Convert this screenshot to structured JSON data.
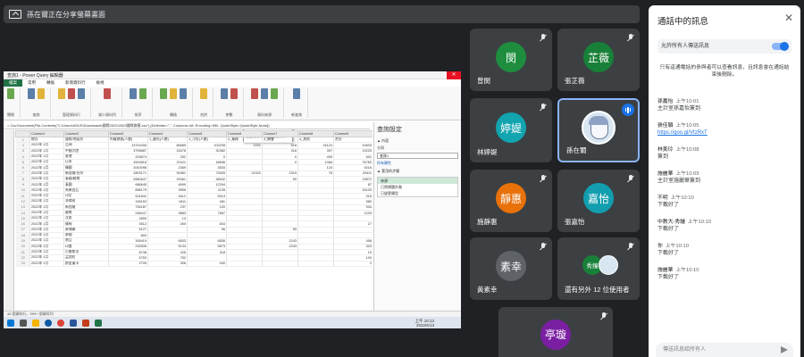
{
  "banner": {
    "text": "孫在爾正在分享螢幕畫面"
  },
  "shared_screen": {
    "window_title": "查詢1 - Power Query 編輯器",
    "tabs": [
      "檔案",
      "常用",
      "轉換",
      "新增資料行",
      "檢視"
    ],
    "ribbon_groups": [
      "關閉",
      "查詢",
      "管理資料行",
      "減少資料列",
      "排序",
      "轉換",
      "合併",
      "參數",
      "資料來源",
      "新查詢"
    ],
    "tooltip": {
      "title": "合併查詢",
      "body": "根據這些欄位中的值來合併這個查詢與另一個查詢的資料。"
    },
    "formula": "= Csv.Document(File.Contents(\"C:\\Users\\ASUS\\Downloads\\國際2022\\2022國際旅客.csv\"),[Delimiter=\",\", Columns=48, Encoding=950, QuoteStyle=QuoteStyle.None])",
    "columns": [
      "",
      "Column1",
      "Column2",
      "Column3",
      "Column4",
      "Column5",
      "Column6",
      "Column7",
      "Column8",
      "Column9"
    ],
    "rows": [
      [
        "1",
        "統計",
        "國際/地區別",
        "外籍旅客(人數)",
        "1_觀光(人數)",
        "1_小計(人數)",
        "2_業務",
        "3_開會",
        "4_其他",
        "合計"
      ],
      [
        "2",
        "2022年 1月",
        "亞洲",
        "13724406",
        "66589",
        "102208",
        "2201",
        "618",
        "24124",
        "10603"
      ],
      [
        "3",
        "2022年 1月",
        "中國大陸",
        "3796887",
        "15478",
        "30382",
        "",
        "316",
        "397",
        "19225"
      ],
      [
        "4",
        "2022年 1月",
        "香港",
        "203874",
        "252",
        "0",
        "",
        "0",
        "405",
        "601"
      ],
      [
        "5",
        "2022年 1月",
        "日本",
        "4524818",
        "22421",
        "18696",
        "",
        "0",
        "1066",
        "76760"
      ],
      [
        "6",
        "2022年 1月",
        "韓國",
        "2043098",
        "2359",
        "3533",
        "",
        "",
        "124",
        "9216"
      ],
      [
        "7",
        "2022年 1月",
        "新加坡/台灣",
        "2803171",
        "91861",
        "72605",
        "21922",
        "2315",
        "78",
        "29411"
      ],
      [
        "8",
        "2022年 1月",
        "泰國/越南",
        "2680647",
        "29361",
        "38942",
        "",
        "59",
        "",
        "23872"
      ],
      [
        "9",
        "2022年 1月",
        "泰國",
        "686645",
        "4699",
        "12294",
        "",
        "",
        "",
        "87"
      ],
      [
        "10",
        "2022年 1月",
        "馬來西亞",
        "858179",
        "2896",
        "1126",
        "",
        "",
        "",
        "16133"
      ],
      [
        "11",
        "2022年 1月",
        "印尼",
        "521842",
        "4612",
        "5913",
        "",
        "",
        "",
        "915"
      ],
      [
        "12",
        "2022年 1月",
        "菲律賓",
        "199153",
        "1811",
        "481",
        "",
        "",
        "",
        "580"
      ],
      [
        "13",
        "2022年 1月",
        "新加坡",
        "754187",
        "237",
        "100",
        "",
        "",
        "",
        "934"
      ],
      [
        "14",
        "2022年 1月",
        "越南",
        "248447",
        "3883",
        "7867",
        "",
        "",
        "",
        "1229"
      ],
      [
        "15",
        "2022年 1月",
        "汶萊",
        "2899",
        "13",
        "",
        "",
        "",
        "",
        ""
      ],
      [
        "16",
        "2022年 1月",
        "緬甸",
        "3512",
        "260",
        "834",
        "",
        "",
        "",
        "27"
      ],
      [
        "17",
        "2022年 1月",
        "柬埔寨",
        "5127",
        "",
        "96",
        "",
        "59",
        "",
        ""
      ],
      [
        "18",
        "2022年 1月",
        "寮國",
        "800",
        "",
        "",
        "",
        "",
        "",
        ""
      ],
      [
        "19",
        "2022年 1月",
        "南亞",
        "309419",
        "6833",
        "6838",
        "",
        "2243",
        "",
        "458"
      ],
      [
        "20",
        "2022年 1月",
        "印度",
        "292835",
        "5134",
        "5873",
        "",
        "2243",
        "",
        "323"
      ],
      [
        "21",
        "2022年 1月",
        "巴基斯坦",
        "8748",
        "426",
        "318",
        "",
        "",
        "",
        "19"
      ],
      [
        "22",
        "2022年 1月",
        "孟加拉",
        "5753",
        "752",
        "",
        "",
        "",
        "",
        "100"
      ],
      [
        "23",
        "2022年 1月",
        "斯里蘭卡",
        "2705",
        "306",
        "440",
        "",
        "",
        "",
        "2"
      ]
    ],
    "query_settings": {
      "title": "查詢設定",
      "properties_label": "▲ 內容",
      "name_label": "名稱",
      "name_value": "查詢1",
      "all_props_link": "所有屬性",
      "steps_label": "▲ 套用的步驟",
      "steps": [
        "來源",
        "已將標題升階",
        "已變更類型"
      ]
    },
    "status": "48 個資料行、999+ 個資料列",
    "clock": {
      "time": "上午 10:13",
      "date": "2022/6/13"
    }
  },
  "participants": [
    {
      "name": "曾閔",
      "initials": "閔",
      "color": "#1e8e3e"
    },
    {
      "name": "張芷薇",
      "initials": "芷薇",
      "color": "#188038"
    },
    {
      "name": "林婷媞",
      "initials": "婷媞",
      "color": "#12a4af"
    },
    {
      "name": "孫在爾",
      "initials": "",
      "color": "#d7e6f0"
    },
    {
      "name": "施靜惠",
      "initials": "靜惠",
      "color": "#e8710a"
    },
    {
      "name": "張嘉怡",
      "initials": "嘉怡",
      "color": "#129eaf"
    },
    {
      "name": "黃素幸",
      "initials": "素幸",
      "color": "#5f6368"
    },
    {
      "name": "還有另外 12 位使用者",
      "initials": "秀鐘",
      "color": "#188038"
    },
    {
      "name": "",
      "initials": "亭璇",
      "color": "#7b1fa2"
    }
  ],
  "chat": {
    "title": "通話中的訊息",
    "toggle_label": "允許所有人傳送訊息",
    "info": "只有這通電話的參與者可以查看訊息，且訊息會在通話結束後刪除。",
    "messages": [
      {
        "who": "孫嘉怡",
        "time": "上午10:01",
        "text": "主計室孫嘉怡簽到",
        "link": false
      },
      {
        "who": "張佳穎",
        "time": "上午10:05",
        "text": "https://goo.gl/VtzRxT",
        "link": true
      },
      {
        "who": "林美玲",
        "time": "上午10:08",
        "text": "簽到",
        "link": false
      },
      {
        "who": "施麗華",
        "time": "上午10:09",
        "text": "主計室施麗華簽到",
        "link": false
      },
      {
        "who": "不明",
        "time": "上午10:10",
        "text": "下載好了",
        "link": false
      },
      {
        "who": "中教大-秀鍾",
        "time": "上午10:10",
        "text": "下載好了",
        "link": false
      },
      {
        "who": "你",
        "time": "上午10:10",
        "text": "下載好了",
        "link": false
      },
      {
        "who": "施麗華",
        "time": "上午10:10",
        "text": "下載好了",
        "link": false
      }
    ],
    "compose_placeholder": "傳送訊息給所有人"
  }
}
